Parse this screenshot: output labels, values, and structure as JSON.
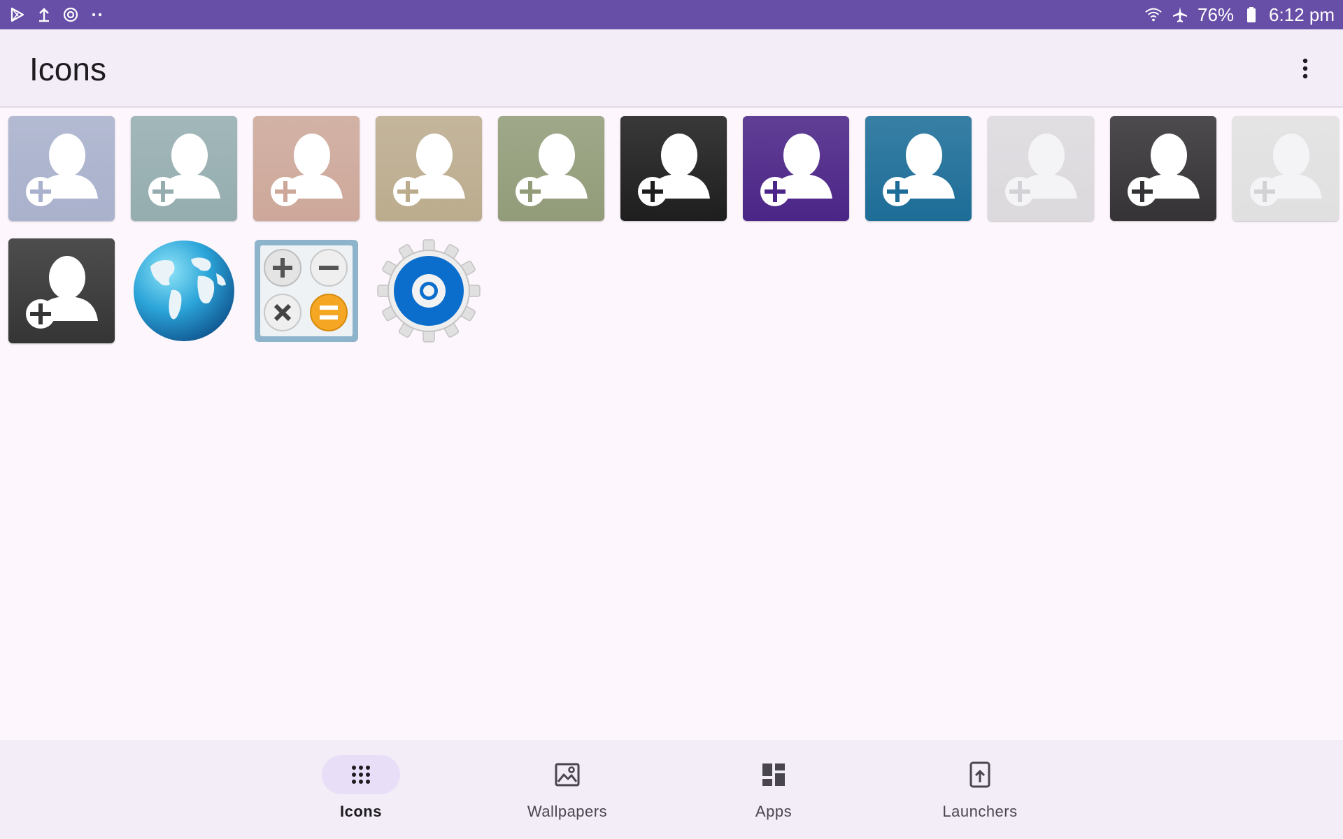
{
  "status_bar": {
    "left_icons": [
      "play-store-icon",
      "upload-icon",
      "sync-icon",
      "more-dots-icon"
    ],
    "battery": "76%",
    "time": "6:12 pm",
    "right_icons": [
      "wifi-icon",
      "airplane-icon",
      "battery-icon"
    ]
  },
  "app_bar": {
    "title": "Icons",
    "menu_icon": "more-vert-icon"
  },
  "icons": [
    {
      "name": "add-contact-icon",
      "color": "#a9b1cc"
    },
    {
      "name": "add-contact-icon",
      "color": "#95adaf"
    },
    {
      "name": "add-contact-icon",
      "color": "#cda89a"
    },
    {
      "name": "add-contact-icon",
      "color": "#bcac8e"
    },
    {
      "name": "add-contact-icon",
      "color": "#929c79"
    },
    {
      "name": "add-contact-icon",
      "color": "#1e1e1e"
    },
    {
      "name": "add-contact-icon",
      "color": "#4b2587"
    },
    {
      "name": "add-contact-icon",
      "color": "#1d6d98"
    },
    {
      "name": "add-contact-icon",
      "color": "#dcd9dd"
    },
    {
      "name": "add-contact-icon",
      "color": "#353335"
    },
    {
      "name": "add-contact-icon",
      "color": "#e0e0e0"
    },
    {
      "name": "add-contact-icon",
      "color": "#353535"
    },
    {
      "name": "globe-icon"
    },
    {
      "name": "calculator-icon"
    },
    {
      "name": "settings-gear-icon"
    }
  ],
  "bottom_nav": {
    "items": [
      {
        "label": "Icons",
        "icon": "apps-grid-icon",
        "active": true
      },
      {
        "label": "Wallpapers",
        "icon": "image-icon",
        "active": false
      },
      {
        "label": "Apps",
        "icon": "dashboard-icon",
        "active": false
      },
      {
        "label": "Launchers",
        "icon": "launcher-icon",
        "active": false
      }
    ]
  },
  "colors": {
    "status_bar": "#674ea7",
    "app_bar": "#f3edf7",
    "background": "#fdf7fd",
    "nav_active_pill": "#e8def8"
  }
}
